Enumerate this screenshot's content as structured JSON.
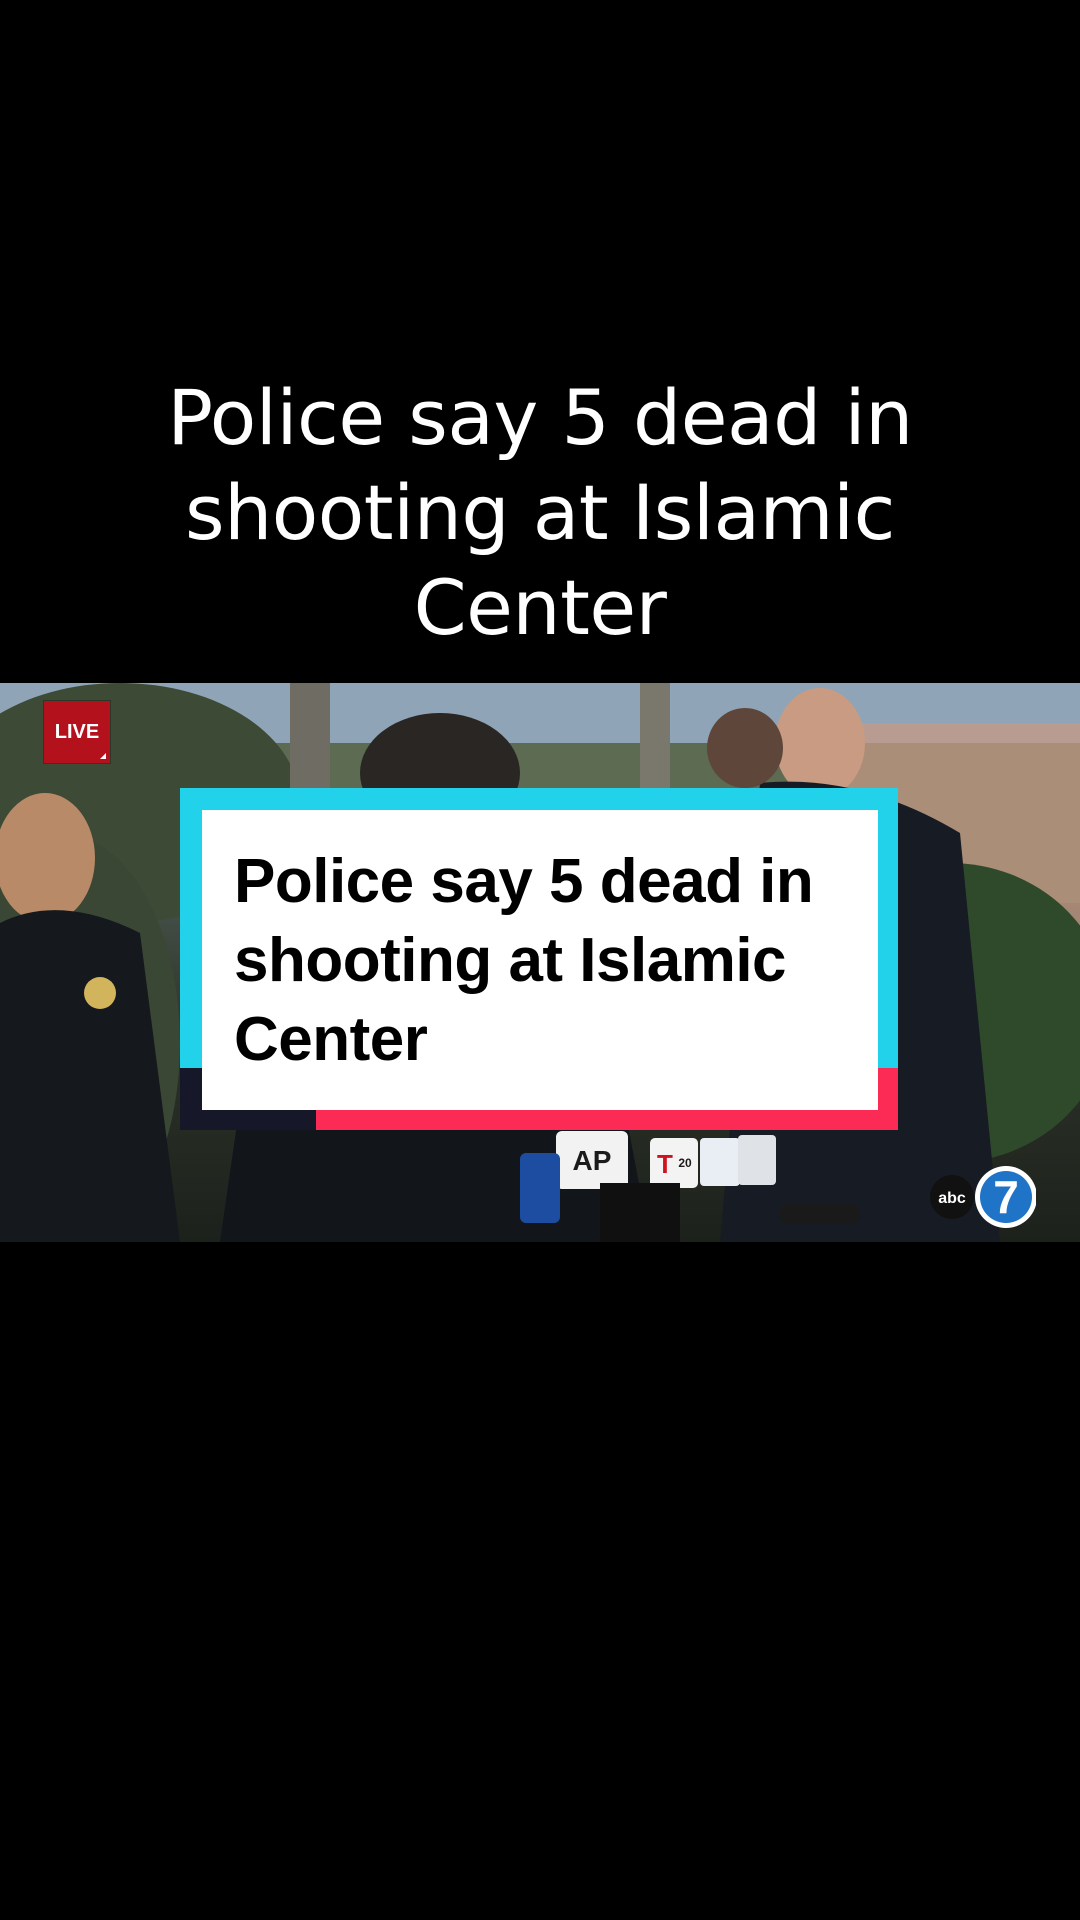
{
  "post": {
    "headline": "Police say 5 dead in shooting at Islamic Center"
  },
  "video": {
    "live_label": "LIVE",
    "card_text": "Police say 5 dead in shooting at Islamic Center",
    "microphone_labels": [
      "AP",
      "T",
      "20"
    ],
    "network_logo_text": "abc",
    "network_logo_number": "7"
  },
  "colors": {
    "background": "#000000",
    "card_cyan": "#21d2ea",
    "card_red": "#fc2b55",
    "card_dark": "#17172a",
    "live_red": "#b3121d"
  }
}
